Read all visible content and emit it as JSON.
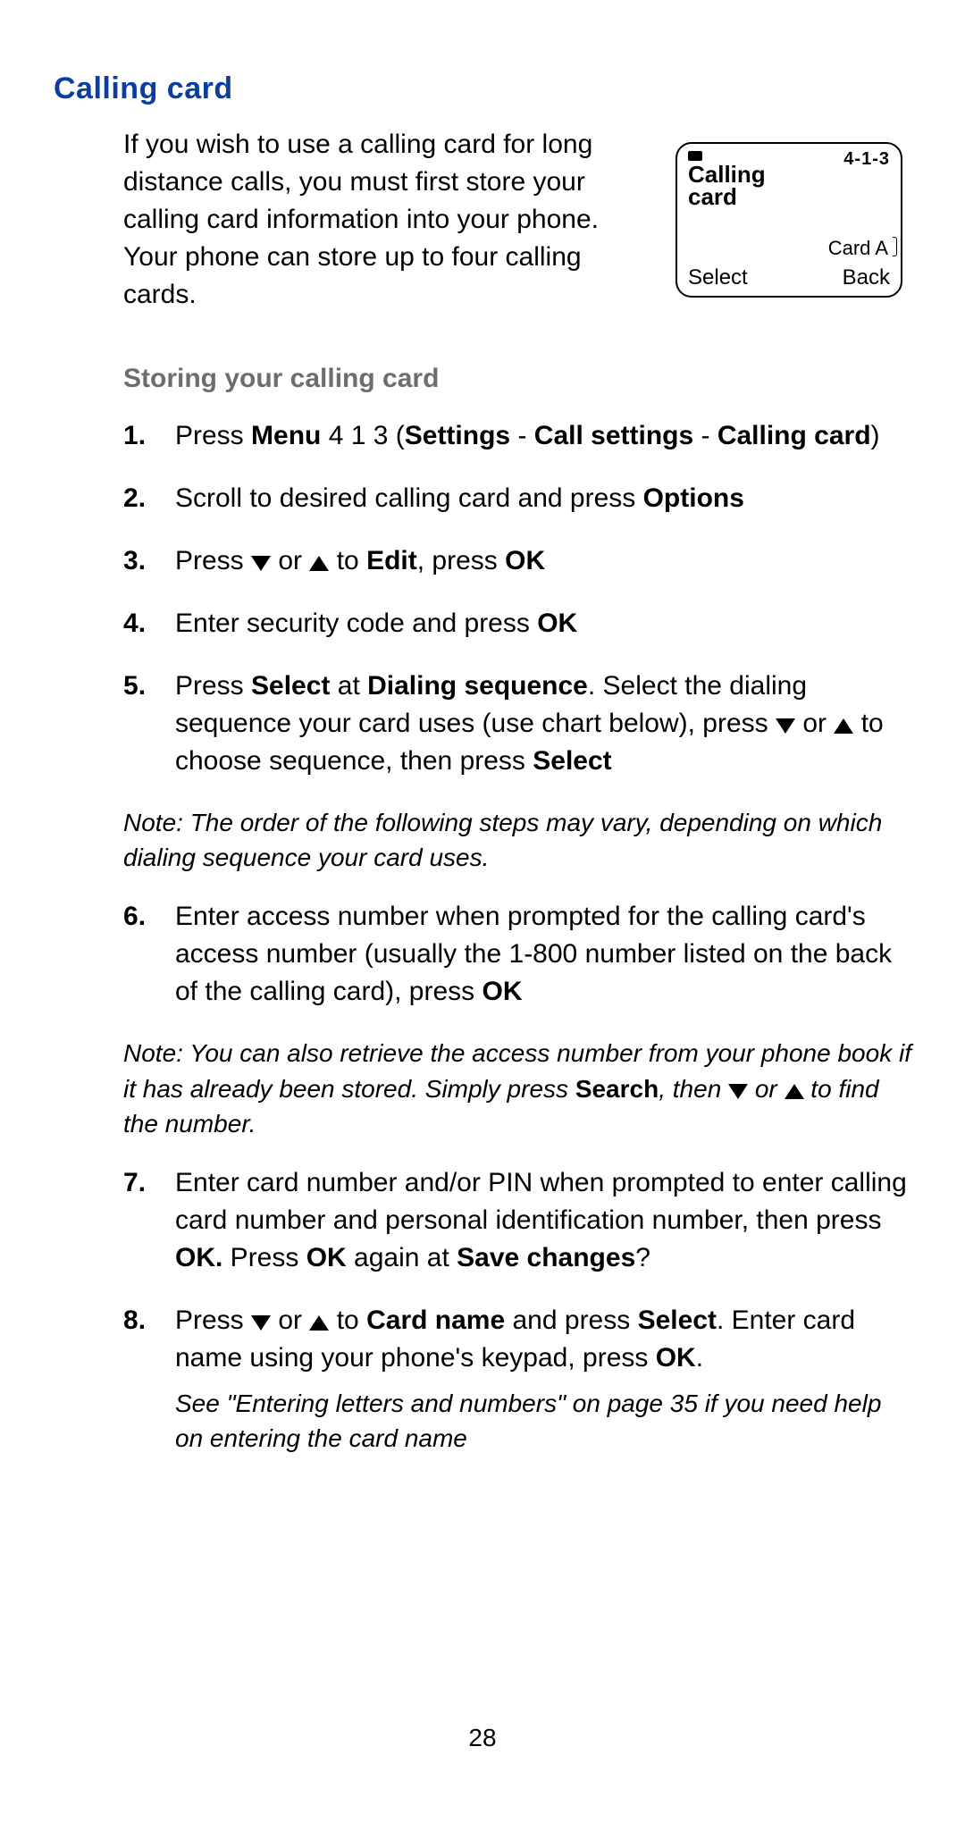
{
  "title": "Calling card",
  "intro": "If you wish to use a calling card for long distance calls, you must first store your calling card information into your phone. Your phone can store up to four calling cards.",
  "phone": {
    "code": "4-1-3",
    "title_line1": "Calling",
    "title_line2": "card",
    "selected": "Card A",
    "left_softkey": "Select",
    "right_softkey": "Back"
  },
  "sub_heading": "Storing your calling card",
  "steps": {
    "s1": {
      "t1": "Press ",
      "menu": "Menu",
      "t2": " 4 1 3 (",
      "path1": "Settings",
      "t3": " - ",
      "path2": "Call settings",
      "t4": " - ",
      "path3": "Calling card",
      "t5": ")"
    },
    "s2": {
      "t1": "Scroll to desired calling card and press ",
      "options": "Options"
    },
    "s3": {
      "t1": "Press ",
      "t2": " or ",
      "t3": " to ",
      "edit": "Edit",
      "t4": ", press ",
      "ok": "OK"
    },
    "s4": {
      "t1": "Enter security code and press ",
      "ok": "OK"
    },
    "s5": {
      "t1": "Press ",
      "select1": "Select",
      "t2": " at ",
      "dseq": "Dialing sequence",
      "t3": ". Select the dialing sequence your card uses (use chart below), press ",
      "t4": " or ",
      "t5": " to choose sequence, then press ",
      "select2": "Select"
    },
    "s6": {
      "t1": "Enter access number when prompted for the calling card's access number (usually the 1-800 number listed on the back of the calling card), press ",
      "ok": "OK"
    },
    "s7": {
      "t1": "Enter card number and/or PIN when prompted to enter calling card number and personal identification number, then press ",
      "ok1": "OK.",
      "t2": " Press ",
      "ok2": "OK",
      "t3": " again at ",
      "save": "Save changes",
      "t4": "?"
    },
    "s8": {
      "t1": "Press ",
      "t2": " or ",
      "t3": " to ",
      "cardname": "Card name",
      "t4": " and press ",
      "select": "Select",
      "t5": ". Enter card name using your phone's keypad, press ",
      "ok": "OK",
      "t6": "."
    }
  },
  "note1": "Note: The order of the following steps may vary, depending on which dialing sequence your card uses.",
  "note2": {
    "t1": "Note: You can also retrieve the access number from your phone book if it has already been stored. Simply press ",
    "search": "Search",
    "t2": ", then ",
    "t3": " or ",
    "t4": " to find the number."
  },
  "see_note": "See \"Entering letters and numbers\" on page 35 if you need help on entering the card name",
  "page_number": "28"
}
